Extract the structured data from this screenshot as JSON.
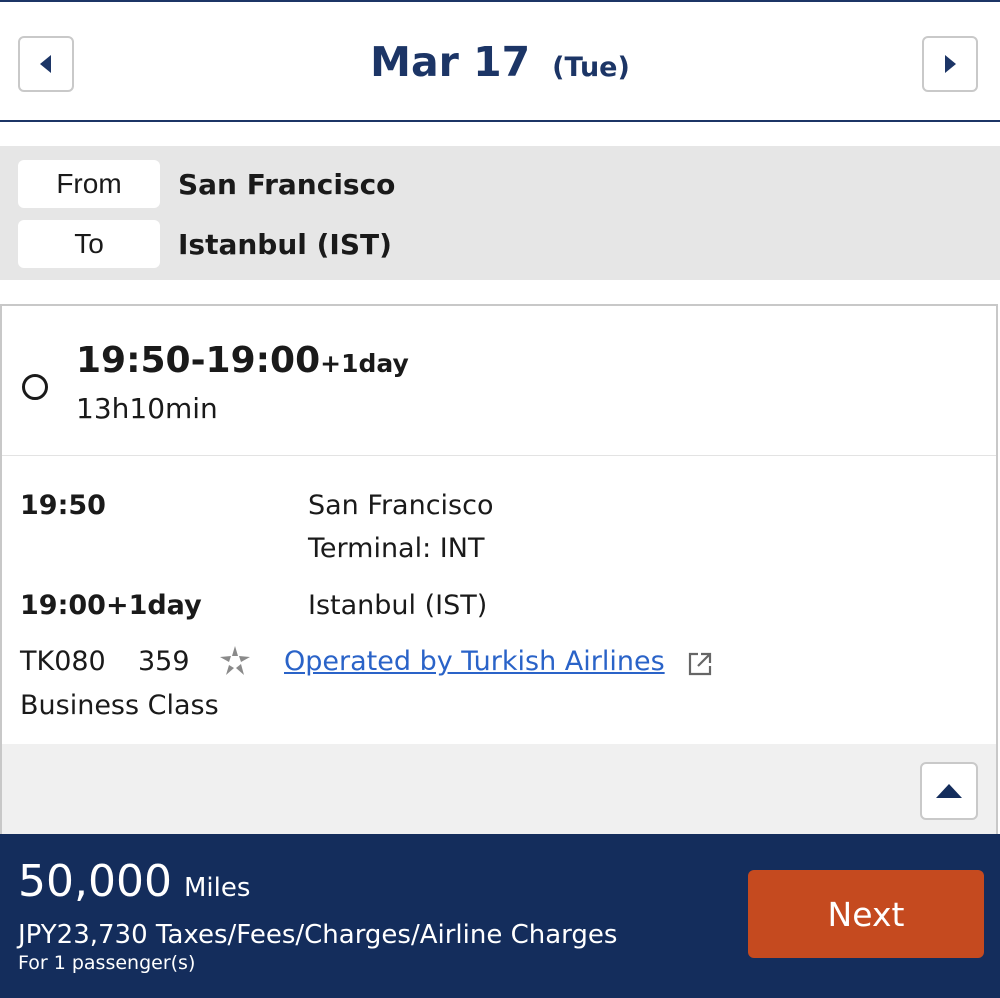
{
  "date_header": {
    "date": "Mar 17",
    "day_of_week": "(Tue)",
    "prev_icon": "caret-left-icon",
    "next_icon": "caret-right-icon"
  },
  "route": {
    "from_label": "From",
    "from_value": "San Francisco",
    "to_label": "To",
    "to_value": "Istanbul (IST)"
  },
  "flight": {
    "time_range": "19:50-19:00",
    "time_plus": "+1day",
    "duration": "13h10min",
    "departure_time": "19:50",
    "departure_city": "San Francisco",
    "departure_terminal": "Terminal: INT",
    "arrival_time": "19:00+1day",
    "arrival_city": "Istanbul (IST)",
    "flight_number": "TK080",
    "aircraft": "359",
    "alliance_icon": "star-alliance-icon",
    "operated_by": "Operated by Turkish Airlines",
    "external_icon": "external-link-icon",
    "cabin": "Business Class",
    "collapse_icon": "caret-up-icon"
  },
  "price": {
    "miles_value": "50,000",
    "miles_unit": "Miles",
    "taxes": "JPY23,730 Taxes/Fees/Charges/Airline Charges",
    "passengers": "For 1 passenger(s)",
    "next_label": "Next"
  },
  "colors": {
    "navy": "#1c3566",
    "price_bar": "#142d5c",
    "next_button": "#c54a1f",
    "link": "#2a63c8",
    "route_bg": "#e6e6e6"
  }
}
